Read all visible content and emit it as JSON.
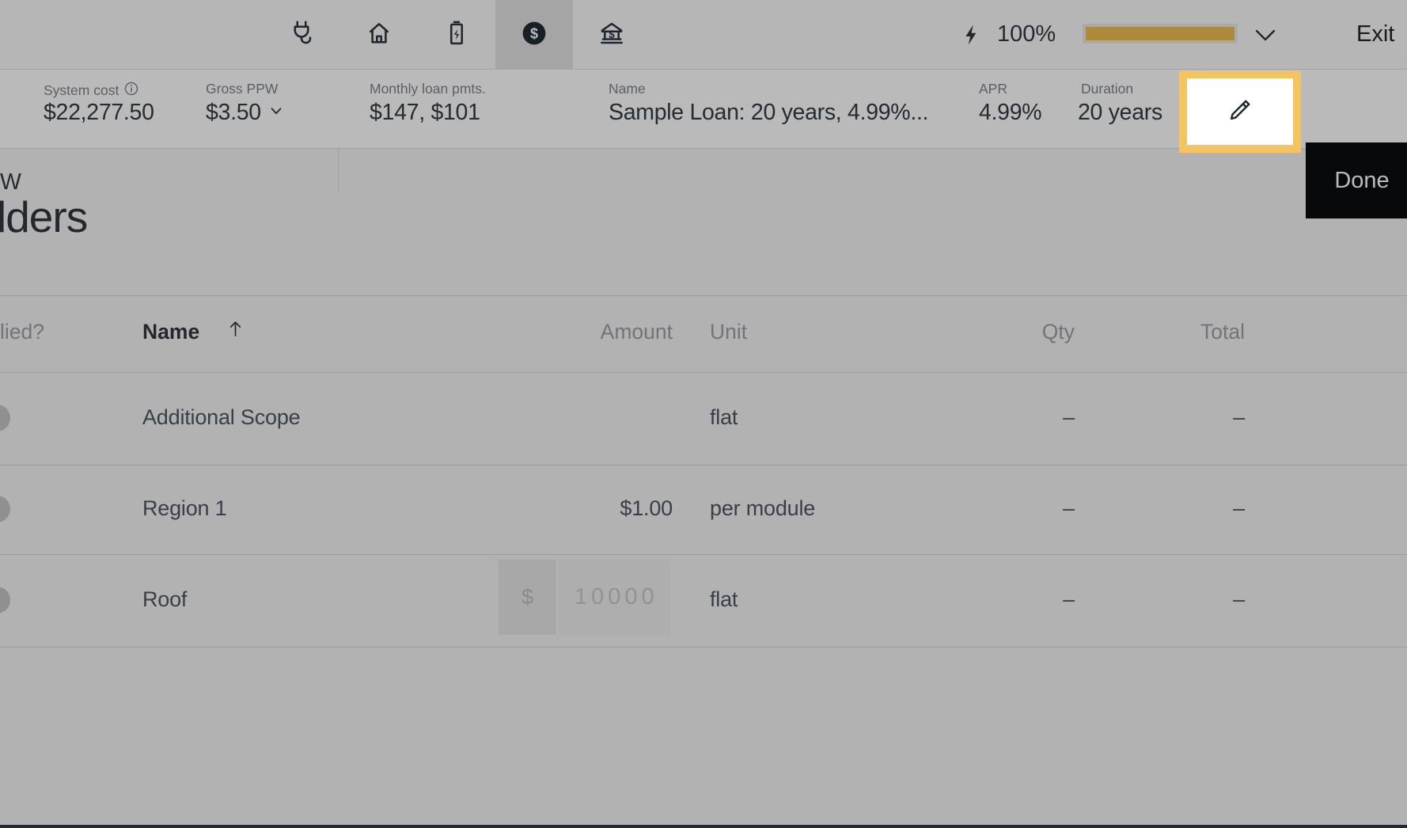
{
  "toolbar": {
    "tabs": [
      {
        "icon": "plug-icon",
        "selected": false
      },
      {
        "icon": "home-icon",
        "selected": false
      },
      {
        "icon": "battery-icon",
        "selected": false
      },
      {
        "icon": "dollar-circle-icon",
        "selected": true
      },
      {
        "icon": "bank-icon",
        "selected": false
      }
    ],
    "offset_percent": "100%",
    "exit_label": "Exit"
  },
  "header": {
    "partial_left_value": "W",
    "system_cost": {
      "label": "System cost",
      "value": "$22,277.50"
    },
    "gross_ppw": {
      "label": "Gross PPW",
      "value": "$3.50"
    },
    "monthly_loan": {
      "label": "Monthly loan pmts.",
      "value": "$147, $101"
    },
    "loan_name": {
      "label": "Name",
      "value": "Sample Loan: 20 years, 4.99%..."
    },
    "apr": {
      "label": "APR",
      "value": "4.99%"
    },
    "duration": {
      "label": "Duration",
      "value": "20 years"
    },
    "done_label": "Done"
  },
  "page": {
    "heading_partial": "lders"
  },
  "adders_table": {
    "headers": {
      "applied_partial": "lied?",
      "name": "Name",
      "amount": "Amount",
      "unit": "Unit",
      "qty": "Qty",
      "total": "Total"
    },
    "rows": [
      {
        "name": "Additional Scope",
        "amount": "",
        "unit": "flat",
        "qty": "–",
        "total": "–"
      },
      {
        "name": "Region 1",
        "amount": "$1.00",
        "unit": "per module",
        "qty": "–",
        "total": "–"
      },
      {
        "name": "Roof",
        "amount_prefix": "$",
        "amount_value": "10000",
        "unit": "flat",
        "qty": "–",
        "total": "–"
      }
    ]
  },
  "colors": {
    "accent_gold": "#f1bd52",
    "highlight_border": "#f5c462",
    "done_button_bg": "#0b0d10",
    "icon_dark": "#2b3540"
  }
}
